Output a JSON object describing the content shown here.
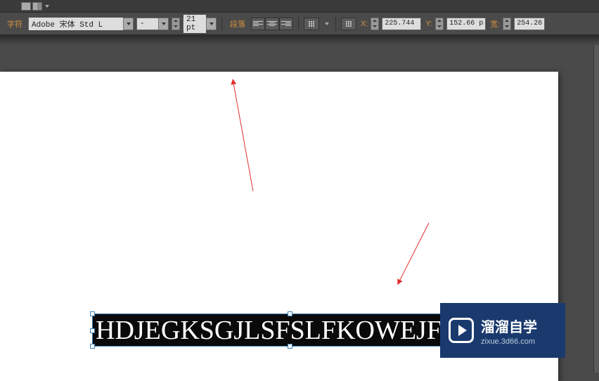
{
  "toolbar": {
    "char_label": "字符",
    "font_family": "Adobe 宋体 Std L",
    "font_style": "-",
    "font_size": "21 pt",
    "para_label": "段落",
    "x_label": "X:",
    "x_value": "225.744 :",
    "y_label": "Y:",
    "y_value": "152.66 p:",
    "w_label": "宽:",
    "w_value": "254.264"
  },
  "canvas": {
    "text_content": "HDJEGKSGJLSFSLFKOWEJF"
  },
  "watermark": {
    "title": "溜溜自学",
    "url": "zixue.3d66.com"
  }
}
